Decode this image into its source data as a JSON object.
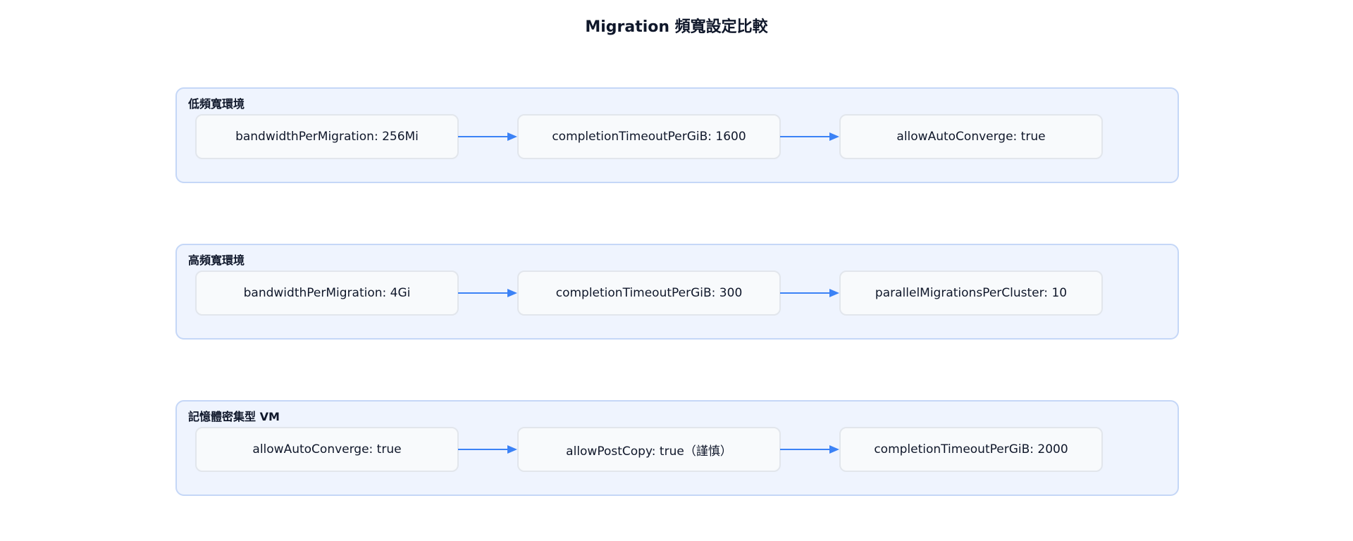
{
  "title": "Migration 頻寬設定比較",
  "colors": {
    "arrow": "#3b82f6",
    "group_fill": "#eff4fe",
    "group_border": "#c5d7f7",
    "node_fill": "#f8fafc",
    "node_border": "#e2e6ec"
  },
  "groups": [
    {
      "label": "低頻寬環境",
      "nodes": [
        "bandwidthPerMigration: 256Mi",
        "completionTimeoutPerGiB: 1600",
        "allowAutoConverge: true"
      ]
    },
    {
      "label": "高頻寬環境",
      "nodes": [
        "bandwidthPerMigration: 4Gi",
        "completionTimeoutPerGiB: 300",
        "parallelMigrationsPerCluster: 10"
      ]
    },
    {
      "label": "記憶體密集型 VM",
      "nodes": [
        "allowAutoConverge: true",
        "allowPostCopy: true（謹慎）",
        "completionTimeoutPerGiB: 2000"
      ]
    }
  ]
}
